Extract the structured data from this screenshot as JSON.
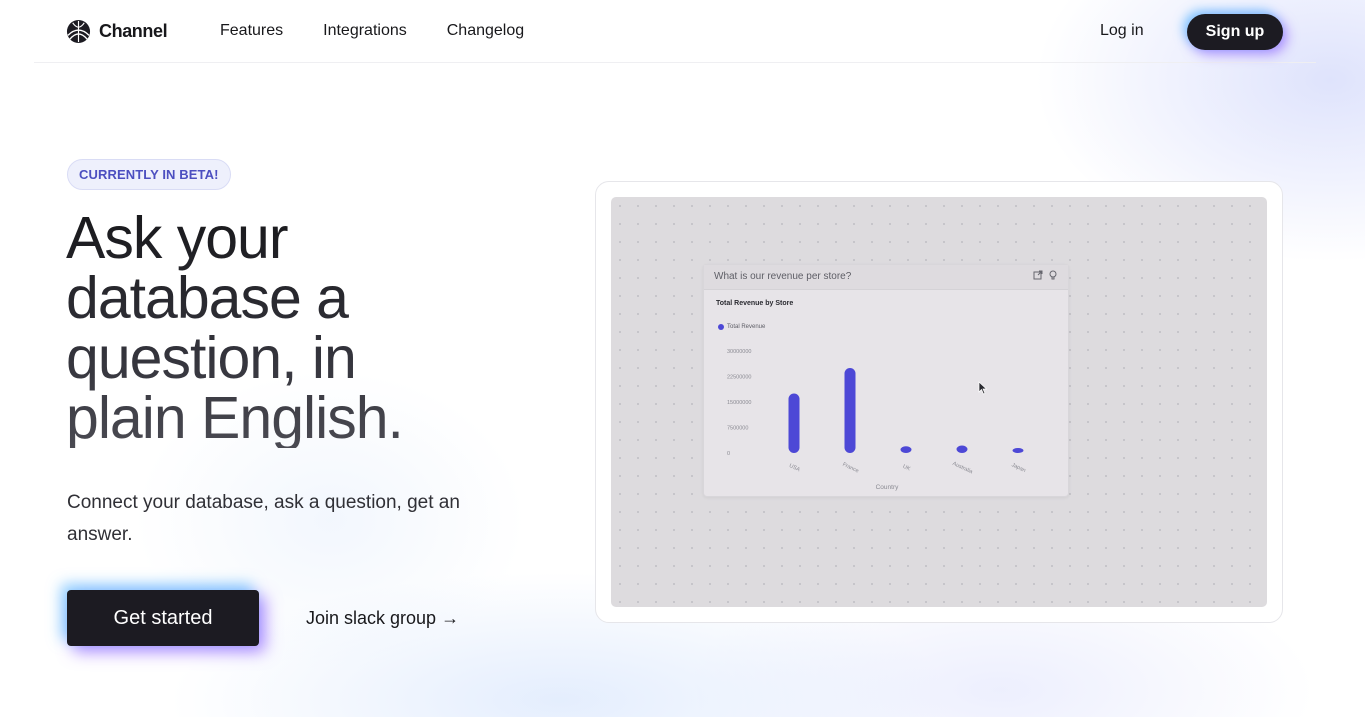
{
  "nav": {
    "brand": "Channel",
    "links": [
      "Features",
      "Integrations",
      "Changelog"
    ],
    "login": "Log in",
    "signup": "Sign up"
  },
  "hero": {
    "badge": "CURRENTLY IN BETA!",
    "headline": "Ask your database a question, in plain English.",
    "subtext": "Connect your database, ask a question, get an answer.",
    "cta": "Get started",
    "secondary": "Join slack group →"
  },
  "preview": {
    "question": "What is our revenue per store?",
    "chart_title": "Total Revenue by Store",
    "legend": "Total Revenue",
    "x_axis_label": "Country",
    "accent": "#4d48d6"
  },
  "chart_data": {
    "type": "bar",
    "title": "Total Revenue by Store",
    "xlabel": "Country",
    "ylabel": "",
    "categories": [
      "USA",
      "France",
      "UK",
      "Australia",
      "Japan"
    ],
    "series": [
      {
        "name": "Total Revenue",
        "values": [
          17500000,
          25000000,
          2000000,
          2200000,
          500000
        ]
      }
    ],
    "y_ticks": [
      "30000000",
      "22500000",
      "15000000",
      "7500000",
      "0"
    ],
    "ylim": [
      0,
      30000000
    ],
    "grid": false,
    "legend_position": "top-left"
  }
}
